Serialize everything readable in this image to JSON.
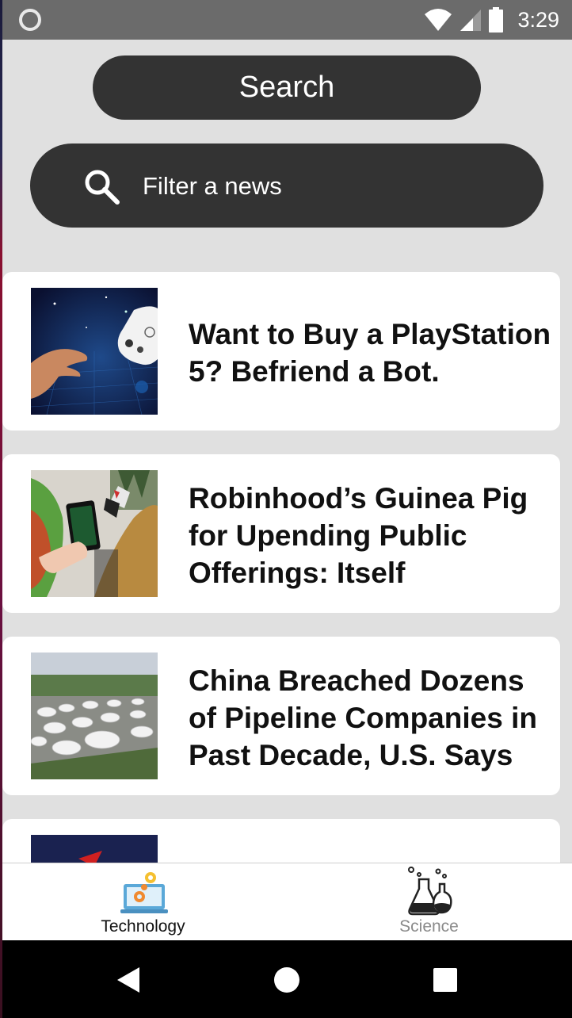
{
  "status_bar": {
    "time": "3:29",
    "icons": [
      "notification-circle-icon",
      "wifi-icon",
      "cellular-signal-icon",
      "battery-icon"
    ]
  },
  "search_button": {
    "label": "Search"
  },
  "filter": {
    "placeholder": "Filter a news"
  },
  "news": [
    {
      "title": "Want to Buy a PlayStation 5? Befriend a Bot.",
      "thumbnail": "hand-and-game-controller"
    },
    {
      "title": "Robinhood’s Guinea Pig for Upending Public Offerings: Itself",
      "thumbnail": "person-holding-phone-on-couch"
    },
    {
      "title": "China Breached Dozens of Pipeline Companies in Past Decade, U.S. Says",
      "thumbnail": "aerial-oil-storage-tanks"
    },
    {
      "title": "",
      "thumbnail": "dark-blue-with-red-stripe"
    }
  ],
  "bottom_nav": {
    "tabs": [
      {
        "label": "Technology",
        "icon": "laptop-gears-icon",
        "active": true
      },
      {
        "label": "Science",
        "icon": "chemistry-flask-icon",
        "active": false
      }
    ]
  },
  "system_nav": {
    "buttons": [
      "back-icon",
      "home-icon",
      "recents-icon"
    ]
  },
  "colors": {
    "status_bar": "#6b6b6b",
    "background": "#e0e0e0",
    "pill": "#333333",
    "card": "#ffffff",
    "active_tab_text": "#111111",
    "inactive_tab_text": "#8a8a8a"
  }
}
